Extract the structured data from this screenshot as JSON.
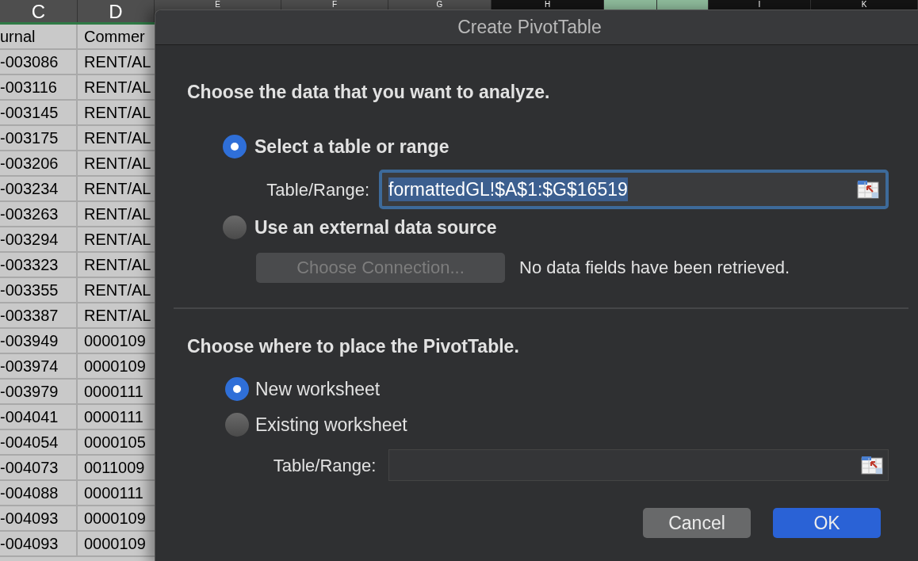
{
  "sheet": {
    "columns": [
      {
        "label": "C",
        "highlighted": false
      },
      {
        "label": "D",
        "highlighted": false
      },
      {
        "label": "E",
        "highlighted": false
      },
      {
        "label": "F",
        "highlighted": false
      },
      {
        "label": "G",
        "highlighted": false
      },
      {
        "label": "H",
        "highlighted": false
      },
      {
        "highlighted": true
      },
      {
        "highlighted": true
      },
      {
        "label": "I",
        "highlighted": false
      },
      {
        "label": "K",
        "highlighted": false
      }
    ],
    "rows": [
      [
        "urnal",
        "Commer"
      ],
      [
        "-003086",
        "RENT/AL"
      ],
      [
        "-003116",
        "RENT/AL"
      ],
      [
        "-003145",
        "RENT/AL"
      ],
      [
        "-003175",
        "RENT/AL"
      ],
      [
        "-003206",
        "RENT/AL"
      ],
      [
        "-003234",
        "RENT/AL"
      ],
      [
        "-003263",
        "RENT/AL"
      ],
      [
        "-003294",
        "RENT/AL"
      ],
      [
        "-003323",
        "RENT/AL"
      ],
      [
        "-003355",
        "RENT/AL"
      ],
      [
        "-003387",
        "RENT/AL"
      ],
      [
        "-003949",
        "0000109"
      ],
      [
        "-003974",
        "0000109"
      ],
      [
        "-003979",
        "0000111"
      ],
      [
        "-004041",
        "0000111"
      ],
      [
        "-004054",
        "0000105"
      ],
      [
        "-004073",
        "0011009"
      ],
      [
        "-004088",
        "0000111"
      ],
      [
        "-004093",
        "0000109"
      ],
      [
        "-004093",
        "0000109"
      ]
    ]
  },
  "dialog": {
    "title": "Create PivotTable",
    "source": {
      "heading": "Choose the data that you want to analyze.",
      "options": [
        {
          "label": "Select a table or range",
          "selected": true
        },
        {
          "label": "Use an external data source",
          "selected": false
        }
      ],
      "range_label": "Table/Range:",
      "range_value": "formattedGL!$A$1:$G$16519",
      "connection_button": {
        "label": "Choose Connection...",
        "disabled": true
      },
      "connection_status": "No data fields have been retrieved."
    },
    "placement": {
      "heading": "Choose where to place the PivotTable.",
      "options": [
        {
          "label": "New worksheet",
          "selected": true
        },
        {
          "label": "Existing worksheet",
          "selected": false
        }
      ],
      "range_label": "Table/Range:"
    },
    "buttons": [
      {
        "label": "Cancel",
        "kind": "secondary"
      },
      {
        "label": "OK",
        "kind": "primary"
      }
    ]
  }
}
